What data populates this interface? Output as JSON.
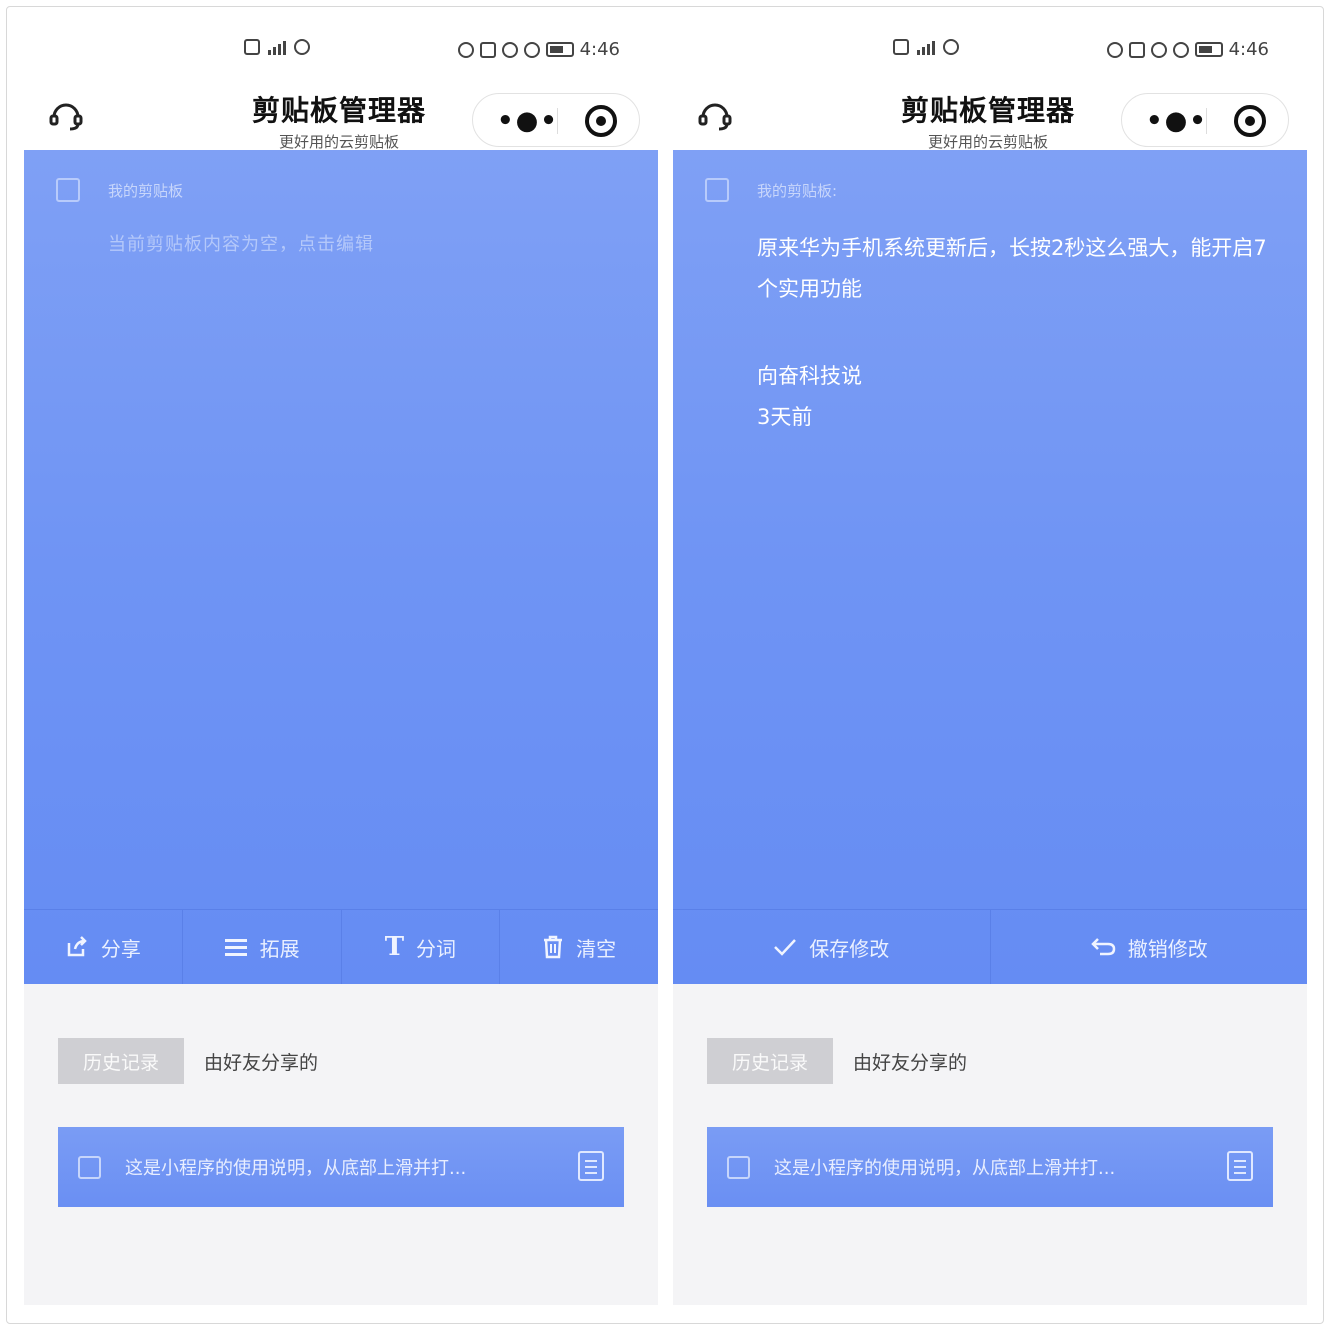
{
  "status_bar": {
    "time": "4:46"
  },
  "header": {
    "title": "剪贴板管理器",
    "subtitle": "更好用的云剪贴板"
  },
  "left_screen": {
    "card_label": "我的剪贴板",
    "placeholder": "当前剪贴板内容为空，点击编辑",
    "toolbar": [
      {
        "icon": "share-icon",
        "label": "分享"
      },
      {
        "icon": "menu-icon",
        "label": "拓展"
      },
      {
        "icon": "text-icon",
        "label": "分词"
      },
      {
        "icon": "trash-icon",
        "label": "清空"
      }
    ]
  },
  "right_screen": {
    "card_label": "我的剪贴板:",
    "content": "原来华为手机系统更新后，长按2秒这么强大，能开启7个实用功能",
    "author": "向奋科技说",
    "time": "3天前",
    "toolbar": [
      {
        "icon": "check-icon",
        "label": "保存修改"
      },
      {
        "icon": "undo-icon",
        "label": "撤销修改"
      }
    ]
  },
  "history": {
    "tab_history": "历史记录",
    "tab_friends": "由好友分享的",
    "item_text": "这是小程序的使用说明，从底部上滑并打..."
  },
  "colors": {
    "card_blue": "#6f94f4",
    "toolbar_divider": "#5a80e8",
    "history_tab_bg": "#cfcfd3"
  }
}
